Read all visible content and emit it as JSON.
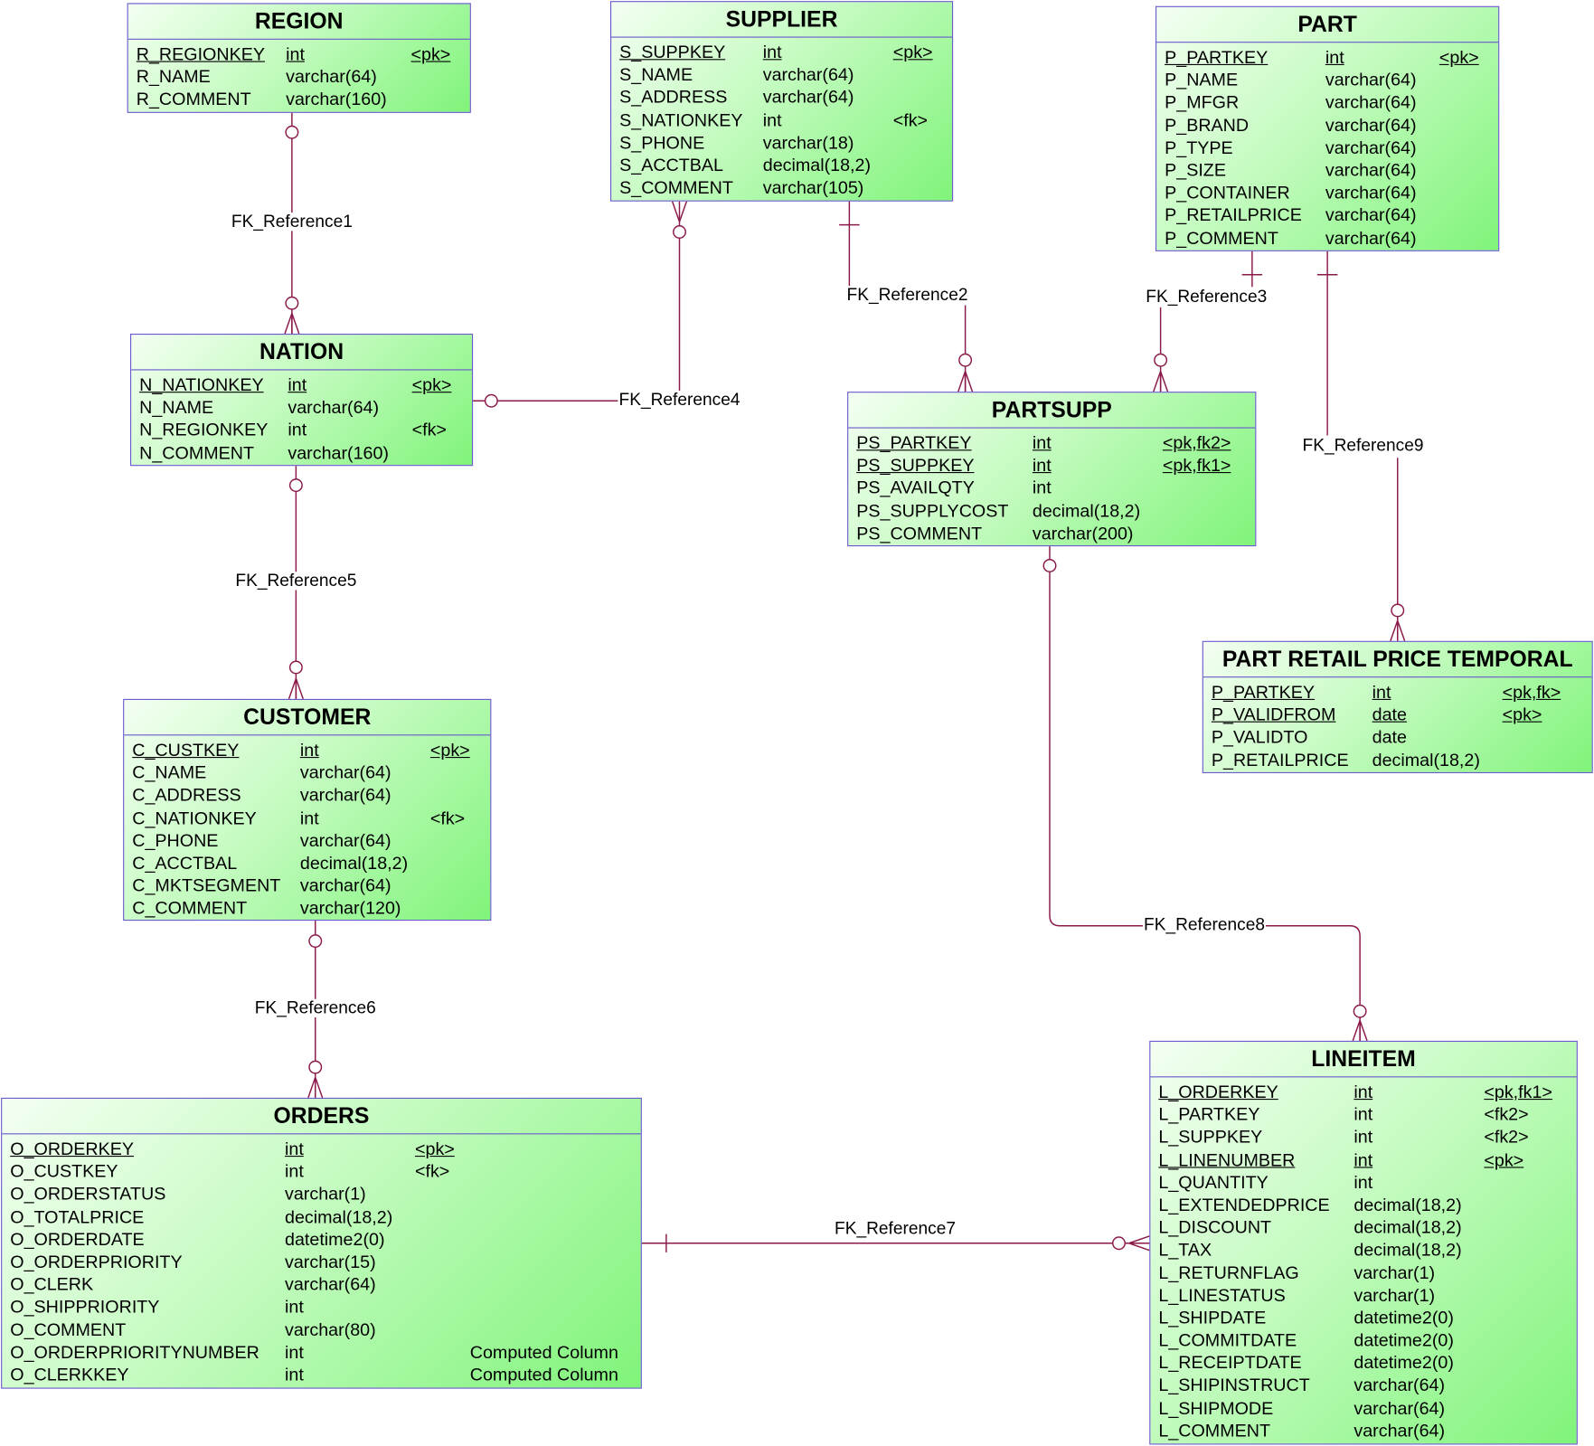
{
  "colors": {
    "border": "#6a5acd",
    "link": "#8b1a4a",
    "fill_end": "#80f47a"
  },
  "entities": [
    {
      "id": "region",
      "title": "REGION",
      "columns": [
        [
          "R_REGIONKEY",
          "int",
          "<pk>",
          true
        ],
        [
          "R_NAME",
          "varchar(64)",
          "",
          false
        ],
        [
          "R_COMMENT",
          "varchar(160)",
          "",
          false
        ]
      ]
    },
    {
      "id": "supplier",
      "title": "SUPPLIER",
      "columns": [
        [
          "S_SUPPKEY",
          "int",
          "<pk>",
          true
        ],
        [
          "S_NAME",
          "varchar(64)",
          "",
          false
        ],
        [
          "S_ADDRESS",
          "varchar(64)",
          "",
          false
        ],
        [
          "S_NATIONKEY",
          "int",
          "<fk>",
          false
        ],
        [
          "S_PHONE",
          "varchar(18)",
          "",
          false
        ],
        [
          "S_ACCTBAL",
          "decimal(18,2)",
          "",
          false
        ],
        [
          "S_COMMENT",
          "varchar(105)",
          "",
          false
        ]
      ]
    },
    {
      "id": "part",
      "title": "PART",
      "columns": [
        [
          "P_PARTKEY",
          "int",
          "<pk>",
          true
        ],
        [
          "P_NAME",
          "varchar(64)",
          "",
          false
        ],
        [
          "P_MFGR",
          "varchar(64)",
          "",
          false
        ],
        [
          "P_BRAND",
          "varchar(64)",
          "",
          false
        ],
        [
          "P_TYPE",
          "varchar(64)",
          "",
          false
        ],
        [
          "P_SIZE",
          "varchar(64)",
          "",
          false
        ],
        [
          "P_CONTAINER",
          "varchar(64)",
          "",
          false
        ],
        [
          "P_RETAILPRICE",
          "varchar(64)",
          "",
          false
        ],
        [
          "P_COMMENT",
          "varchar(64)",
          "",
          false
        ]
      ]
    },
    {
      "id": "nation",
      "title": "NATION",
      "columns": [
        [
          "N_NATIONKEY",
          "int",
          "<pk>",
          true
        ],
        [
          "N_NAME",
          "varchar(64)",
          "",
          false
        ],
        [
          "N_REGIONKEY",
          "int",
          "<fk>",
          false
        ],
        [
          "N_COMMENT",
          "varchar(160)",
          "",
          false
        ]
      ]
    },
    {
      "id": "partsupp",
      "title": "PARTSUPP",
      "columns": [
        [
          "PS_PARTKEY",
          "int",
          "<pk,fk2>",
          true
        ],
        [
          "PS_SUPPKEY",
          "int",
          "<pk,fk1>",
          true
        ],
        [
          "PS_AVAILQTY",
          "int",
          "",
          false
        ],
        [
          "PS_SUPPLYCOST",
          "decimal(18,2)",
          "",
          false
        ],
        [
          "PS_COMMENT",
          "varchar(200)",
          "",
          false
        ]
      ]
    },
    {
      "id": "part-retail-price-temporal",
      "title": "PART RETAIL PRICE TEMPORAL",
      "columns": [
        [
          "P_PARTKEY",
          "int",
          "<pk,fk>",
          true
        ],
        [
          "P_VALIDFROM",
          "date",
          "<pk>",
          true
        ],
        [
          "P_VALIDTO",
          "date",
          "",
          false
        ],
        [
          "P_RETAILPRICE",
          "decimal(18,2)",
          "",
          false
        ]
      ]
    },
    {
      "id": "customer",
      "title": "CUSTOMER",
      "columns": [
        [
          "C_CUSTKEY",
          "int",
          "<pk>",
          true
        ],
        [
          "C_NAME",
          "varchar(64)",
          "",
          false
        ],
        [
          "C_ADDRESS",
          "varchar(64)",
          "",
          false
        ],
        [
          "C_NATIONKEY",
          "int",
          "<fk>",
          false
        ],
        [
          "C_PHONE",
          "varchar(64)",
          "",
          false
        ],
        [
          "C_ACCTBAL",
          "decimal(18,2)",
          "",
          false
        ],
        [
          "C_MKTSEGMENT",
          "varchar(64)",
          "",
          false
        ],
        [
          "C_COMMENT",
          "varchar(120)",
          "",
          false
        ]
      ]
    },
    {
      "id": "orders",
      "title": "ORDERS",
      "columns": [
        [
          "O_ORDERKEY",
          "int",
          "<pk>",
          true
        ],
        [
          "O_CUSTKEY",
          "int",
          "<fk>",
          false
        ],
        [
          "O_ORDERSTATUS",
          "varchar(1)",
          "",
          false
        ],
        [
          "O_TOTALPRICE",
          "decimal(18,2)",
          "",
          false
        ],
        [
          "O_ORDERDATE",
          "datetime2(0)",
          "",
          false
        ],
        [
          "O_ORDERPRIORITY",
          "varchar(15)",
          "",
          false
        ],
        [
          "O_CLERK",
          "varchar(64)",
          "",
          false
        ],
        [
          "O_SHIPPRIORITY",
          "int",
          "",
          false
        ],
        [
          "O_COMMENT",
          "varchar(80)",
          "",
          false
        ],
        [
          "O_ORDERPRIORITYNUMBER",
          "int",
          "Computed Column",
          false
        ],
        [
          "O_CLERKKEY",
          "int",
          "Computed Column",
          false
        ]
      ]
    },
    {
      "id": "lineitem",
      "title": "LINEITEM",
      "columns": [
        [
          "L_ORDERKEY",
          "int",
          "<pk,fk1>",
          true
        ],
        [
          "L_PARTKEY",
          "int",
          "<fk2>",
          false
        ],
        [
          "L_SUPPKEY",
          "int",
          "<fk2>",
          false
        ],
        [
          "L_LINENUMBER",
          "int",
          "<pk>",
          true
        ],
        [
          "L_QUANTITY",
          "int",
          "",
          false
        ],
        [
          "L_EXTENDEDPRICE",
          "decimal(18,2)",
          "",
          false
        ],
        [
          "L_DISCOUNT",
          "decimal(18,2)",
          "",
          false
        ],
        [
          "L_TAX",
          "decimal(18,2)",
          "",
          false
        ],
        [
          "L_RETURNFLAG",
          "varchar(1)",
          "",
          false
        ],
        [
          "L_LINESTATUS",
          "varchar(1)",
          "",
          false
        ],
        [
          "L_SHIPDATE",
          "datetime2(0)",
          "",
          false
        ],
        [
          "L_COMMITDATE",
          "datetime2(0)",
          "",
          false
        ],
        [
          "L_RECEIPTDATE",
          "datetime2(0)",
          "",
          false
        ],
        [
          "L_SHIPINSTRUCT",
          "varchar(64)",
          "",
          false
        ],
        [
          "L_SHIPMODE",
          "varchar(64)",
          "",
          false
        ],
        [
          "L_COMMENT",
          "varchar(64)",
          "",
          false
        ]
      ]
    }
  ],
  "references": [
    "FK_Reference1",
    "FK_Reference2",
    "FK_Reference3",
    "FK_Reference4",
    "FK_Reference5",
    "FK_Reference6",
    "FK_Reference7",
    "FK_Reference8",
    "FK_Reference9"
  ]
}
